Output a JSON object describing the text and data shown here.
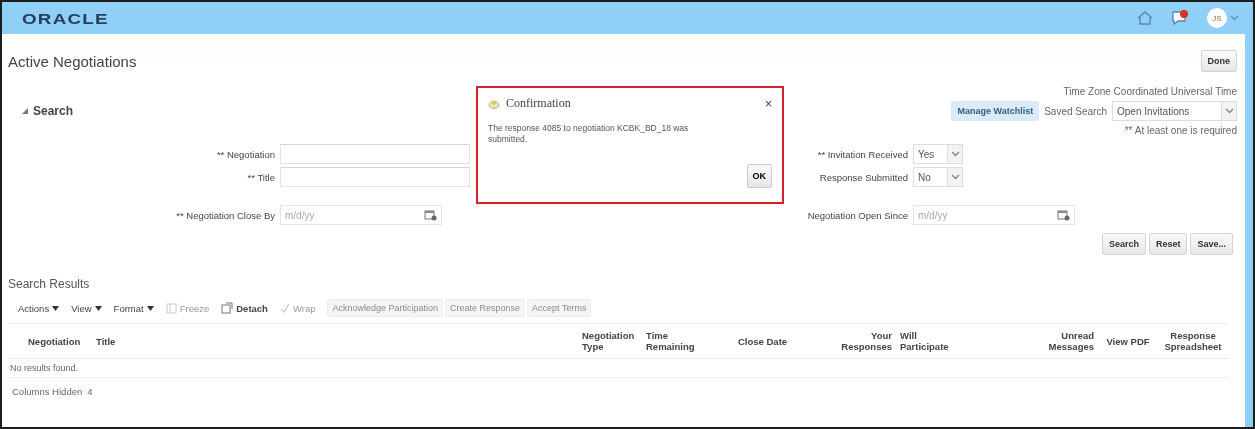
{
  "header": {
    "logo": "ORACLE",
    "avatar_initials": "JS"
  },
  "page": {
    "title": "Active Negotiations",
    "done_button": "Done"
  },
  "search": {
    "heading": "Search",
    "time_zone": "Time Zone Coordinated Universal Time",
    "watchlist_button": "Manage Watchlist",
    "saved_search_label": "Saved Search",
    "saved_search_value": "Open Invitations",
    "required_note": "** At least one is required",
    "left_fields": [
      {
        "label": "** Negotiation",
        "kind": "text"
      },
      {
        "label": "** Title",
        "kind": "text"
      },
      {
        "label": "** Negotiation Close By",
        "kind": "date",
        "placeholder": "m/d/yy"
      }
    ],
    "right_fields": [
      {
        "label": "** Invitation Received",
        "kind": "select",
        "value": "Yes"
      },
      {
        "label": "Response Submitted",
        "kind": "select",
        "value": "No"
      },
      {
        "label": "Negotiation Open Since",
        "kind": "date",
        "placeholder": "m/d/yy"
      }
    ],
    "buttons": [
      "Search",
      "Reset",
      "Save..."
    ]
  },
  "results": {
    "title": "Search Results",
    "menus": [
      "Actions",
      "View",
      "Format"
    ],
    "tools": [
      {
        "label": "Freeze",
        "kind": "freeze",
        "disabled": true
      },
      {
        "label": "Detach",
        "kind": "detach",
        "disabled": false
      },
      {
        "label": "Wrap",
        "kind": "wrap",
        "disabled": true
      }
    ],
    "actions": [
      {
        "label": "Acknowledge Participation",
        "disabled": true
      },
      {
        "label": "Create Response",
        "disabled": true
      },
      {
        "label": "Accept Terms",
        "disabled": true
      }
    ],
    "columns": [
      "Negotiation",
      "Title",
      "Negotiation Type",
      "Time Remaining",
      "Close Date",
      "Your Responses",
      "Will Participate",
      "Unread Messages",
      "View PDF",
      "Response Spreadsheet"
    ],
    "empty_text": "No results found.",
    "columns_hidden_label": "Columns Hidden",
    "columns_hidden_count": "4"
  },
  "dialog": {
    "title": "Confirmation",
    "close_icon": "×",
    "message": "The response 4085 to negotiation KCBK_BD_18 was submitted.",
    "ok_button": "OK"
  }
}
